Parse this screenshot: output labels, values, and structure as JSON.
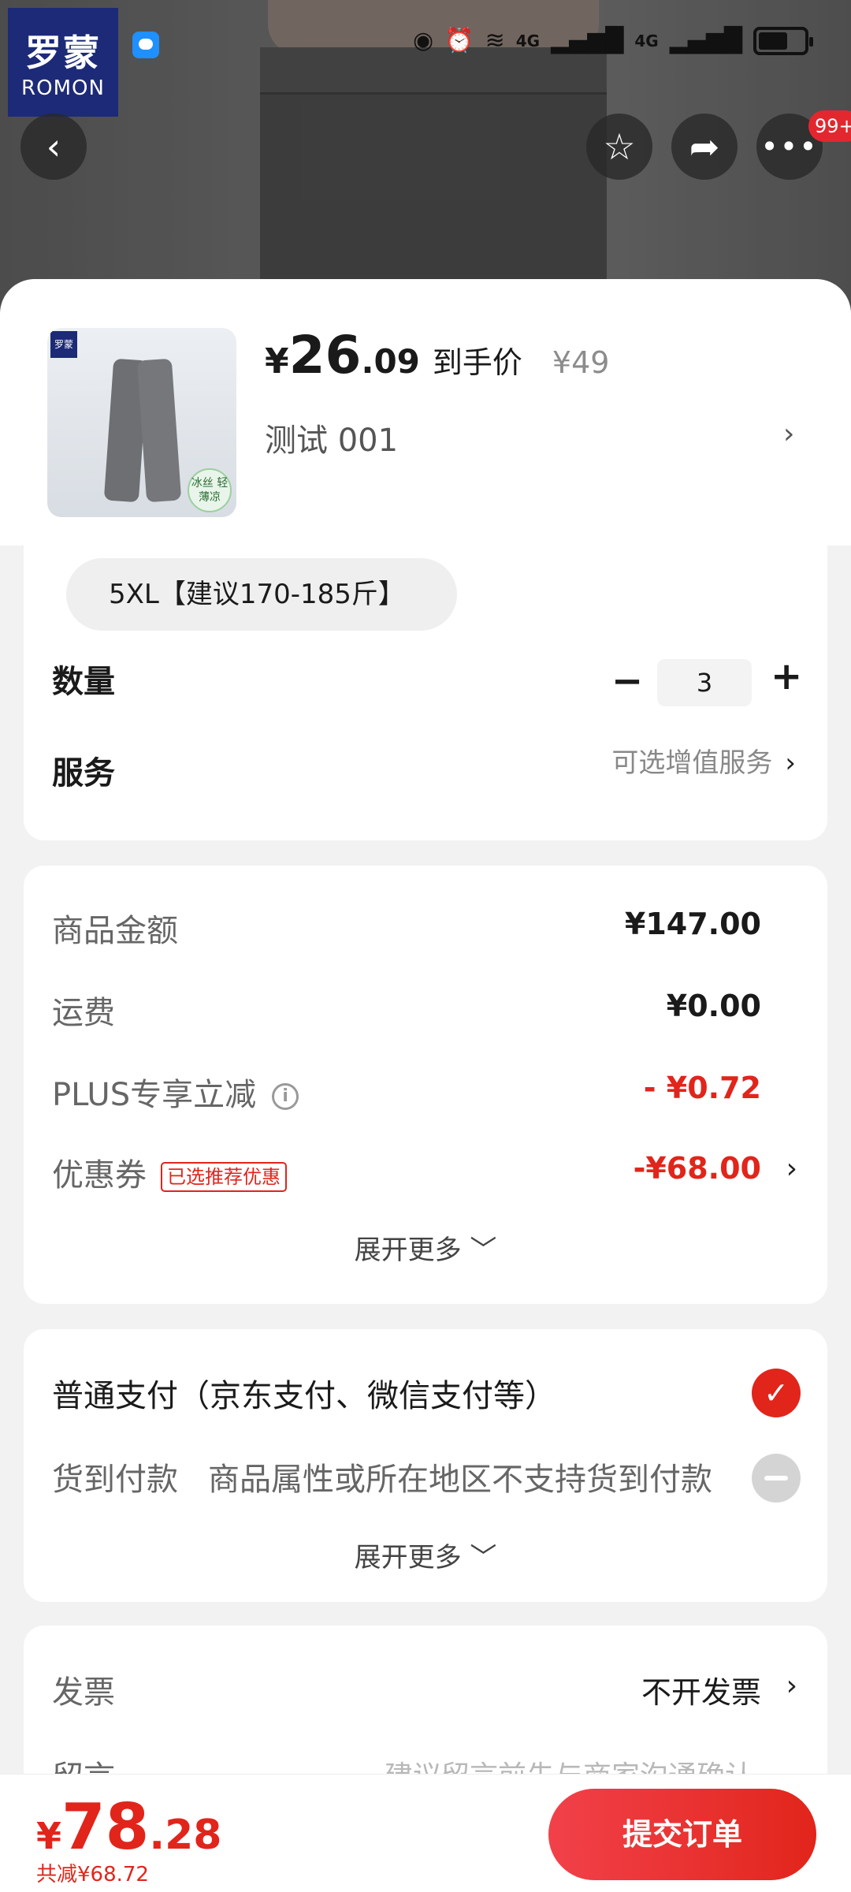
{
  "status_bar": {
    "network1": "4G",
    "network2": "4G"
  },
  "brand": {
    "logo_cn": "罗蒙",
    "logo_en": "ROMON"
  },
  "nav": {
    "more_badge": "99+"
  },
  "product": {
    "price_symbol": "¥",
    "price_int": "26",
    "price_dec": ".09",
    "price_tag": "到手价",
    "original_price": "¥49",
    "spec_text": "测试  001",
    "thumb_badge": "冰丝 轻薄凉"
  },
  "options": {
    "size_chip": "5XL【建议170-185斤】",
    "quantity_label": "数量",
    "quantity_value": "3",
    "service_label": "服务",
    "service_hint": "可选增值服务"
  },
  "fees": {
    "goods_label": "商品金额",
    "goods_value": "¥147.00",
    "shipping_label": "运费",
    "shipping_value": "¥0.00",
    "plus_label": "PLUS专享立减",
    "plus_value": "- ¥0.72",
    "coupon_label": "优惠券",
    "coupon_tag": "已选推荐优惠",
    "coupon_value": "-¥68.00",
    "expand_label": "展开更多"
  },
  "payment": {
    "normal_label": "普通支付（京东支付、微信支付等）",
    "cod_label": "货到付款",
    "cod_note": "商品属性或所在地区不支持货到付款",
    "expand_label": "展开更多"
  },
  "invoice": {
    "label": "发票",
    "value": "不开发票",
    "note_label": "留言",
    "note_placeholder": "建议留言前先与商家沟通确认"
  },
  "footer": {
    "total_symbol": "¥",
    "total_int": "78",
    "total_dec": ".28",
    "saved_text": "共减¥68.72",
    "submit_label": "提交订单"
  },
  "colors": {
    "accent_red": "#e1251b",
    "brand_navy": "#1c2a78"
  }
}
